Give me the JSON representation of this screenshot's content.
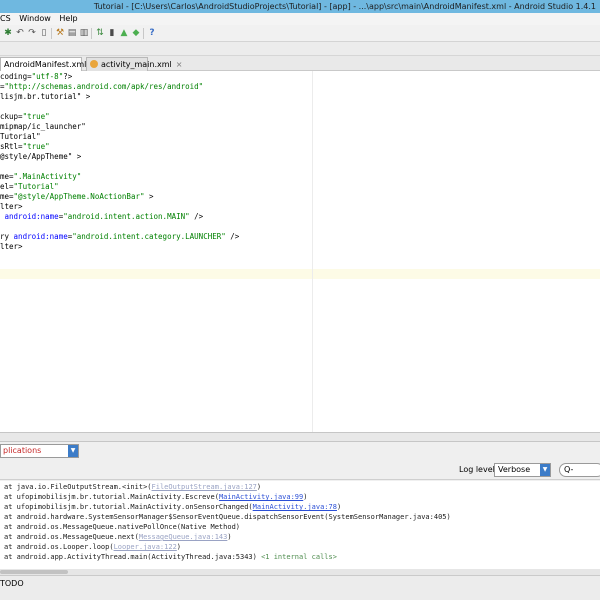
{
  "window": {
    "title": "Tutorial - [C:\\Users\\Carlos\\AndroidStudioProjects\\Tutorial] - [app] - ...\\app\\src\\main\\AndroidManifest.xml - Android Studio 1.4.1"
  },
  "menu": {
    "item_cs": "CS",
    "item_window": "Window",
    "item_help": "Help"
  },
  "tabs": [
    {
      "label": "AndroidManifest.xml",
      "close": "×"
    },
    {
      "label": "activity_main.xml",
      "close": "×"
    }
  ],
  "code_lines": [
    {
      "text": "coding=\"utf-8\"?>"
    },
    {
      "text": "=\"http://schemas.android.com/apk/res/android\""
    },
    {
      "text": "lisjm.br.tutorial\" >"
    },
    {
      "text": ""
    },
    {
      "text": "ckup=\"true\""
    },
    {
      "text": "mipmap/ic_launcher\""
    },
    {
      "text": "Tutorial\""
    },
    {
      "text": "sRtl=\"true\""
    },
    {
      "text": "@style/AppTheme\" >"
    },
    {
      "text": ""
    },
    {
      "text": "me=\".MainActivity\""
    },
    {
      "text": "el=\"Tutorial\""
    },
    {
      "text": "me=\"@style/AppTheme.NoActionBar\" >"
    },
    {
      "text": "lter>"
    },
    {
      "text": " android:name=\"android.intent.action.MAIN\" />"
    },
    {
      "text": ""
    },
    {
      "text": "ry android:name=\"android.intent.category.LAUNCHER\" />"
    },
    {
      "text": "lter>"
    }
  ],
  "logcat": {
    "app_filter": "plications",
    "log_level_label": "Log level:",
    "log_level_value": "Verbose",
    "search_placeholder": "Q-",
    "lines": [
      {
        "prefix": "at java.io.FileOutputStream.<init>(",
        "link": "FileOutputStream.java:127",
        "suffix": ")"
      },
      {
        "prefix": "at ufopimobilisjm.br.tutorial.MainActivity.Escreve(",
        "link": "MainActivity.java:99",
        "suffix": ")"
      },
      {
        "prefix": "at ufopimobilisjm.br.tutorial.MainActivity.onSensorChanged(",
        "link": "MainActivity.java:78",
        "suffix": ")"
      },
      {
        "prefix": "at android.hardware.SystemSensorManager$SensorEventQueue.dispatchSensorEvent(SystemSensorManager.java:405)",
        "link": "",
        "suffix": ""
      },
      {
        "prefix": "at android.os.MessageQueue.nativePollOnce(Native Method)",
        "link": "",
        "suffix": ""
      },
      {
        "prefix": "at android.os.MessageQueue.next(",
        "link": "MessageQueue.java:143",
        "suffix": ")"
      },
      {
        "prefix": "at android.os.Looper.loop(",
        "link": "Looper.java:122",
        "suffix": ")"
      },
      {
        "prefix": "at android.app.ActivityThread.main(ActivityThread.java:5343) ",
        "link": "",
        "suffix": "",
        "internal": "<1 internal calls>"
      }
    ]
  },
  "statusbar": {
    "todo": "TODO"
  }
}
